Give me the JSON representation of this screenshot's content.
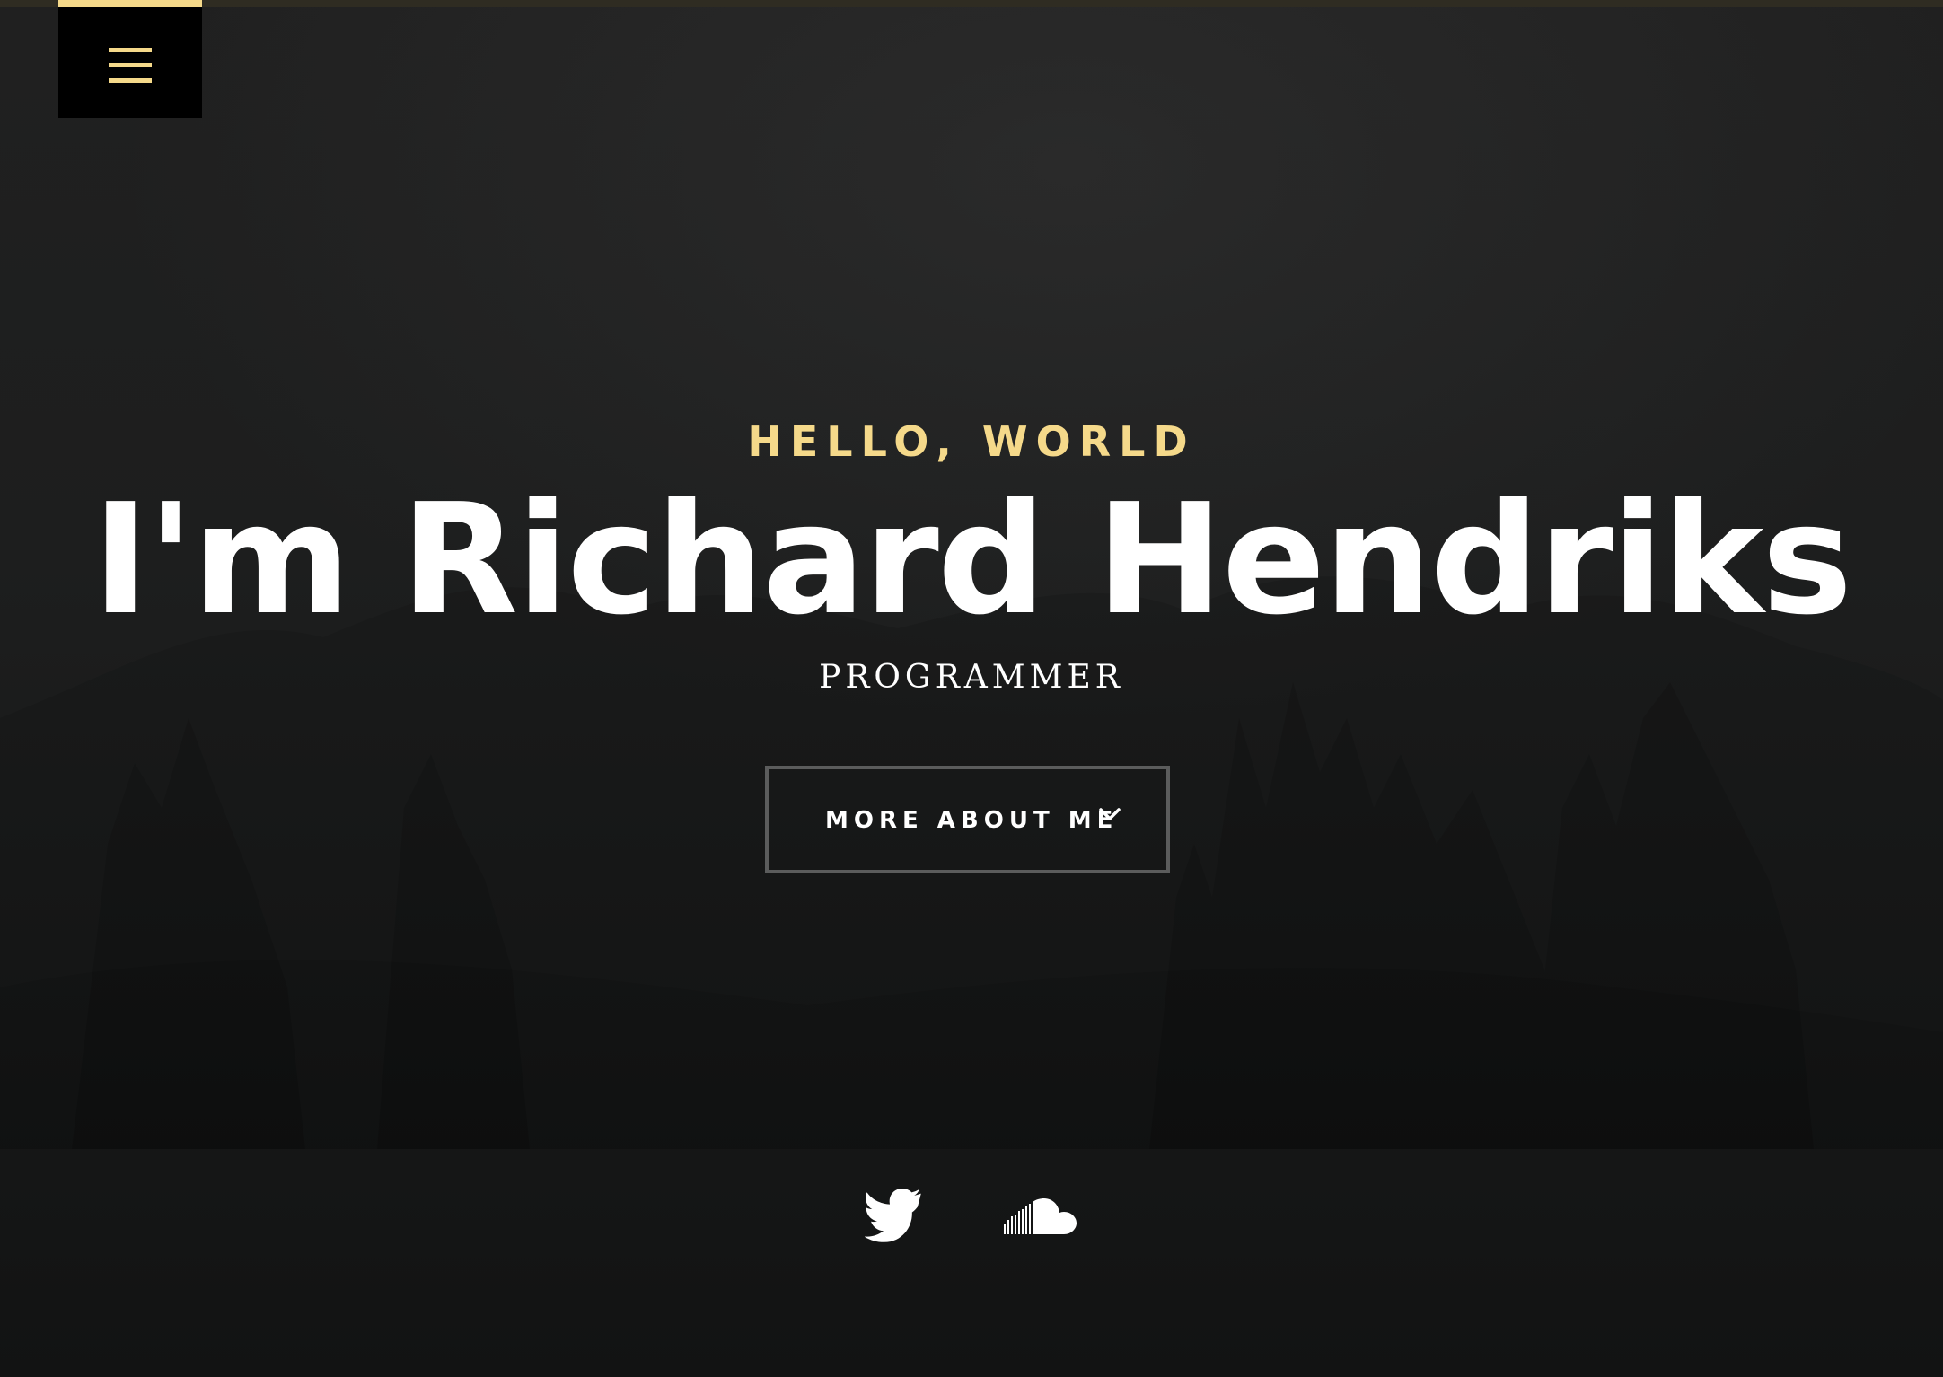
{
  "colors": {
    "accent": "#f5d98a",
    "text": "#ffffff",
    "menu_bg": "#000000",
    "button_border": "#5b5c5c",
    "background": "#1d1e1e"
  },
  "nav": {
    "menu_icon": "hamburger-menu-icon"
  },
  "hero": {
    "greeting": "HELLO, WORLD",
    "name": "I'm Richard Hendriks",
    "role": "PROGRAMMER",
    "cta_label": "MORE ABOUT ME",
    "cta_icon": "chevron-down-icon"
  },
  "social": [
    {
      "icon": "twitter-icon"
    },
    {
      "icon": "soundcloud-icon"
    }
  ]
}
